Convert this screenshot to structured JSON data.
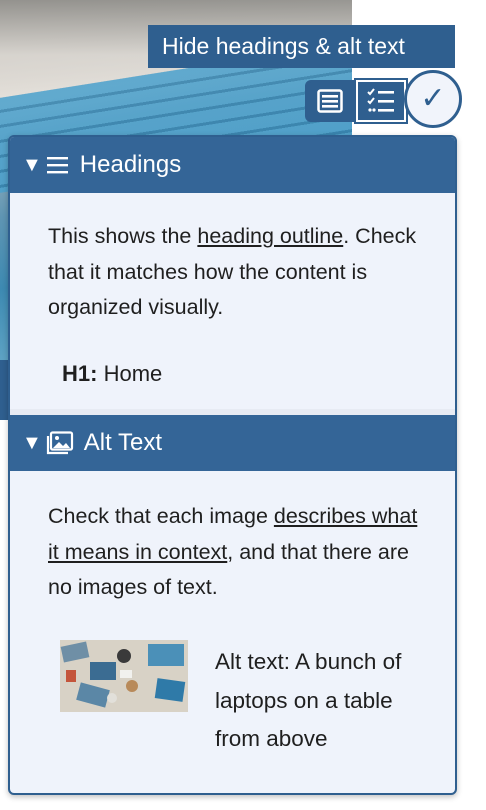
{
  "toggle": {
    "label": "Hide headings & alt text"
  },
  "toolbar": {
    "buttons": [
      {
        "icon": "table-icon"
      },
      {
        "icon": "checklist-icon"
      }
    ],
    "check_glyph": "✓"
  },
  "headings_section": {
    "title": "Headings",
    "triangle": "▼",
    "intro_before": "This shows the ",
    "intro_link": "heading outline",
    "intro_after": ". Check that it matches how the content is organized visually.",
    "entry_level": "H1:",
    "entry_text": "Home"
  },
  "alt_section": {
    "title": "Alt Text",
    "triangle": "▼",
    "intro_before": "Check that each image ",
    "intro_link": "describes what it means in context",
    "intro_after": ", and that there are no images of text.",
    "caption": "Alt text: A bunch of laptops on a table from above"
  },
  "colors": {
    "accent": "#2f5f8f",
    "header": "#346597",
    "panel_bg": "#eff3fb"
  }
}
